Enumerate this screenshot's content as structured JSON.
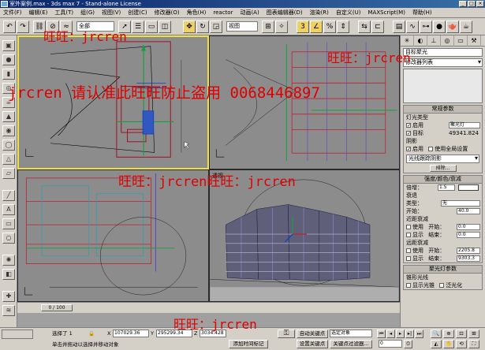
{
  "window": {
    "title": "室外案例.max - 3ds max 7 - Stand-alone License"
  },
  "menu": [
    "文件(F)",
    "编辑(E)",
    "工具(T)",
    "组(G)",
    "视图(V)",
    "创建(C)",
    "修改器(O)",
    "角色(H)",
    "reactor",
    "动画(A)",
    "图表编辑器(D)",
    "渲染(R)",
    "自定义(U)",
    "MAXScript(M)",
    "帮助(H)"
  ],
  "toolbar": {
    "selection_filter": "全部",
    "ref_coord": "视图"
  },
  "viewports": {
    "perspective_label": "透视"
  },
  "watermarks": {
    "w1": "旺旺：jrcren",
    "w2": "旺旺：jrcren",
    "w3": "jrcren 请认准此旺旺防止盗用 0068446897",
    "w4": "旺旺：jrcren旺旺：jrcren",
    "w5": "旺旺：jrcren"
  },
  "command_panel": {
    "modifier_list": "修改器列表",
    "object_name": "目标聚光",
    "general": {
      "title": "常规参数",
      "light_type_label": "灯光类型",
      "enable_label": "启用",
      "light_type_value": "聚光灯",
      "target_label": "目标",
      "target_distance": "49341.824",
      "shadow_label": "阴影",
      "shadow_enable": "启用",
      "use_global": "使用全局设置",
      "shadow_type": "光线跟踪阴影",
      "exclude_btn": "排除..."
    },
    "intensity": {
      "title": "强度/颜色/衰减",
      "multiplier_label": "倍增：",
      "multiplier_value": "1.5",
      "decay_label": "衰退",
      "type_label": "类型：",
      "type_value": "无",
      "start_label": "开始：",
      "start_value": "40.0",
      "near_label": "近距衰减",
      "use_label": "使用",
      "show_label": "显示",
      "near_start_label": "开始：",
      "near_start_value": "0.0",
      "near_end_label": "结束：",
      "near_end_value": "0.0",
      "far_label": "远距衰减",
      "far_start_label": "开始：",
      "far_start_value": "2205.8",
      "far_end_label": "结束：",
      "far_end_value": "9303.3"
    },
    "spot": {
      "title": "聚光灯参数",
      "cone_label": "锥形光线",
      "show_cone": "显示光锥",
      "overshoot": "泛光化"
    }
  },
  "timeline": {
    "frame": "0 / 100"
  },
  "status": {
    "selected": "选择了 1",
    "x_label": "X",
    "x_value": "107029.36",
    "y_label": "Y",
    "y_value": "295299.34",
    "z_label": "Z",
    "z_value": "3034.428",
    "auto_key": "自动关键点",
    "set_key": "设置关键点",
    "key_filter_a": "选定对象",
    "key_filter_btn": "关键点过滤器...",
    "prompt": "单击并拖动以选择并移动对象",
    "add_time_tag": "添加时间标记",
    "frame_value": "0"
  }
}
